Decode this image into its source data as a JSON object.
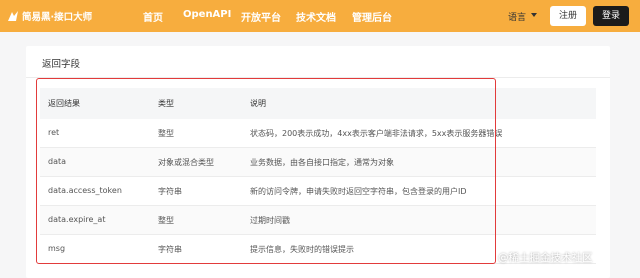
{
  "header": {
    "brand": "简易黑·接口大师",
    "nav": [
      "首页",
      "OpenAPI",
      "开放平台",
      "技术文档",
      "管理后台"
    ],
    "language": "语言",
    "register_label": "注册",
    "login_label": "登录"
  },
  "section": {
    "title": "返回字段"
  },
  "table": {
    "columns": [
      "返回结果",
      "类型",
      "说明"
    ],
    "rows": [
      [
        "ret",
        "整型",
        "状态码，200表示成功，4xx表示客户端非法请求，5xx表示服务器错误"
      ],
      [
        "data",
        "对象或混合类型",
        "业务数据，由各自接口指定，通常为对象"
      ],
      [
        "data.access_token",
        "字符串",
        "新的访问令牌，申请失败时返回空字符串，包含登录的用户ID"
      ],
      [
        "data.expire_at",
        "整型",
        "过期时间戳"
      ],
      [
        "msg",
        "字符串",
        "提示信息，失败时的错误提示"
      ]
    ]
  },
  "watermark": "@稀土掘金技术社区",
  "colors": {
    "header_bg": "#f7ad3e",
    "highlight_border": "#e23b3b",
    "login_bg": "#1b1b1b"
  }
}
